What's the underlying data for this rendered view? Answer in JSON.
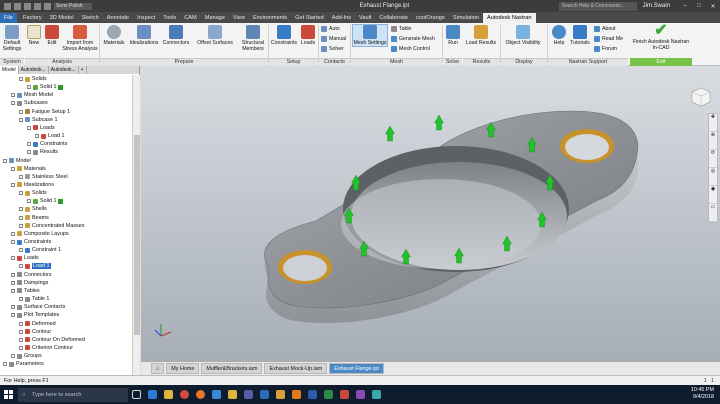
{
  "window": {
    "title": "Exhaust Flange.ipt",
    "search_placeholder": "Search Help & Commands...",
    "user": "Jim.Swain",
    "controls": [
      "–",
      "□",
      "✕"
    ],
    "quick_access_tab": "Semi-Polish"
  },
  "ribbon_tabs": [
    "File",
    "Factory",
    "3D Model",
    "Sketch",
    "Annotate",
    "Inspect",
    "Tools",
    "CAM",
    "Manage",
    "View",
    "Environments",
    "Get Started",
    "Add-Ins",
    "Vault",
    "Collaborate",
    "coolOrange",
    "Simulation",
    "Autodesk Nastran"
  ],
  "active_tab": "Autodesk Nastran",
  "ribbon": {
    "default_settings": "Default Settings",
    "new": "New",
    "edit": "Edit",
    "import": "Import from Stress Analysis",
    "materials": "Materials",
    "idealizations": "Idealizations",
    "connectors": "Connectors",
    "offset_surfaces": "Offset Surfaces",
    "structural_members": "Structural Members",
    "constraints": "Constraints",
    "loads": "Loads",
    "auto": "Auto",
    "manual": "Manual",
    "solver": "Solver",
    "mesh_settings": "Mesh Settings",
    "table": "Table",
    "generate_mesh": "Generate Mesh",
    "mesh_control": "Mesh Control",
    "run": "Run",
    "load_results": "Load Results",
    "object_visibility": "Object Visibility",
    "help": "Help",
    "tutorials": "Tutorials",
    "about": "About",
    "read_me": "Read Me",
    "forum": "Forum",
    "finish": "Finish Autodesk Nastran In-CAD",
    "groups": [
      "System",
      "Analysis",
      "Prepare",
      "Setup",
      "Contacts",
      "Mesh",
      "Solve",
      "Results",
      "Display",
      "Nastran Support",
      "Exit"
    ]
  },
  "browser": {
    "tabs": [
      "Model",
      "Autodesk...",
      "Autodesk..."
    ],
    "tree": [
      {
        "label": "Solids",
        "lvl": 2,
        "icon": "#c9a03a"
      },
      {
        "label": "Solid 1",
        "lvl": 3,
        "icon": "#5aa83a",
        "badge": true
      },
      {
        "label": "Mesh Model",
        "lvl": 1,
        "icon": "#6a8fc2"
      },
      {
        "label": "Subcases",
        "lvl": 1,
        "icon": "#8a8a8a"
      },
      {
        "label": "Fatigue Setup 1",
        "lvl": 2,
        "icon": "#b07a3a"
      },
      {
        "label": "Subcase 1",
        "lvl": 2,
        "icon": "#6a8fc2"
      },
      {
        "label": "Loads",
        "lvl": 3,
        "icon": "#c94a3a"
      },
      {
        "label": "Load 1",
        "lvl": 4,
        "icon": "#c94a3a"
      },
      {
        "label": "Constraints",
        "lvl": 3,
        "icon": "#3a7ac9"
      },
      {
        "label": "Results",
        "lvl": 3,
        "icon": "#8a8a8a"
      },
      {
        "label": "Model",
        "lvl": 0,
        "icon": "#6a8fc2"
      },
      {
        "label": "Materials",
        "lvl": 1,
        "icon": "#c9a03a"
      },
      {
        "label": "Stainless Steel",
        "lvl": 2,
        "icon": "#9a9a9a"
      },
      {
        "label": "Idealizations",
        "lvl": 1,
        "icon": "#c9a03a"
      },
      {
        "label": "Solids",
        "lvl": 2,
        "icon": "#c9a03a"
      },
      {
        "label": "Solid 1",
        "lvl": 3,
        "icon": "#5aa83a",
        "badge": true
      },
      {
        "label": "Shells",
        "lvl": 2,
        "icon": "#c9a03a"
      },
      {
        "label": "Beams",
        "lvl": 2,
        "icon": "#c9a03a"
      },
      {
        "label": "Concentrated Masses",
        "lvl": 2,
        "icon": "#c9a03a"
      },
      {
        "label": "Composite Layups",
        "lvl": 1,
        "icon": "#c9a03a"
      },
      {
        "label": "Constraints",
        "lvl": 1,
        "icon": "#3a7ac9"
      },
      {
        "label": "Constraint 1",
        "lvl": 2,
        "icon": "#3a7ac9"
      },
      {
        "label": "Loads",
        "lvl": 1,
        "icon": "#c94a3a"
      },
      {
        "label": "Load 1",
        "lvl": 2,
        "icon": "#c94a3a",
        "selected": true
      },
      {
        "label": "Connectors",
        "lvl": 1,
        "icon": "#8a8a8a"
      },
      {
        "label": "Dampings",
        "lvl": 1,
        "icon": "#8a8a8a"
      },
      {
        "label": "Tables",
        "lvl": 1,
        "icon": "#8a8a8a"
      },
      {
        "label": "Table 1",
        "lvl": 2,
        "icon": "#8a8a8a"
      },
      {
        "label": "Surface Contacts",
        "lvl": 1,
        "icon": "#8a8a8a"
      },
      {
        "label": "Plot Templates",
        "lvl": 1,
        "icon": "#8a8a8a"
      },
      {
        "label": "Deformed",
        "lvl": 2,
        "icon": "#c94a3a"
      },
      {
        "label": "Contour",
        "lvl": 2,
        "icon": "#c94a3a"
      },
      {
        "label": "Contour On Deformed",
        "lvl": 2,
        "icon": "#c94a3a"
      },
      {
        "label": "Criterion Contour",
        "lvl": 2,
        "icon": "#c94a3a"
      },
      {
        "label": "Groups",
        "lvl": 1,
        "icon": "#8a8a8a"
      },
      {
        "label": "Parameters",
        "lvl": 0,
        "icon": "#8a8a8a"
      }
    ]
  },
  "doc_tabs": [
    "My Home",
    "Muffler&Brackets.iam",
    "Exhaust Mock-Up.iam",
    "Exhaust Flange.ipt"
  ],
  "status": {
    "text": "For Help, press F1",
    "nums": [
      "1",
      "1"
    ]
  },
  "taskbar": {
    "search_placeholder": "Type here to search",
    "time": "10:45 PM",
    "date": "9/4/2018"
  },
  "colors": {
    "accent": "#2d6db5",
    "exit": "#79c24a",
    "load_arrow": "#22c22a",
    "bolt_ring": "#c8922a"
  }
}
